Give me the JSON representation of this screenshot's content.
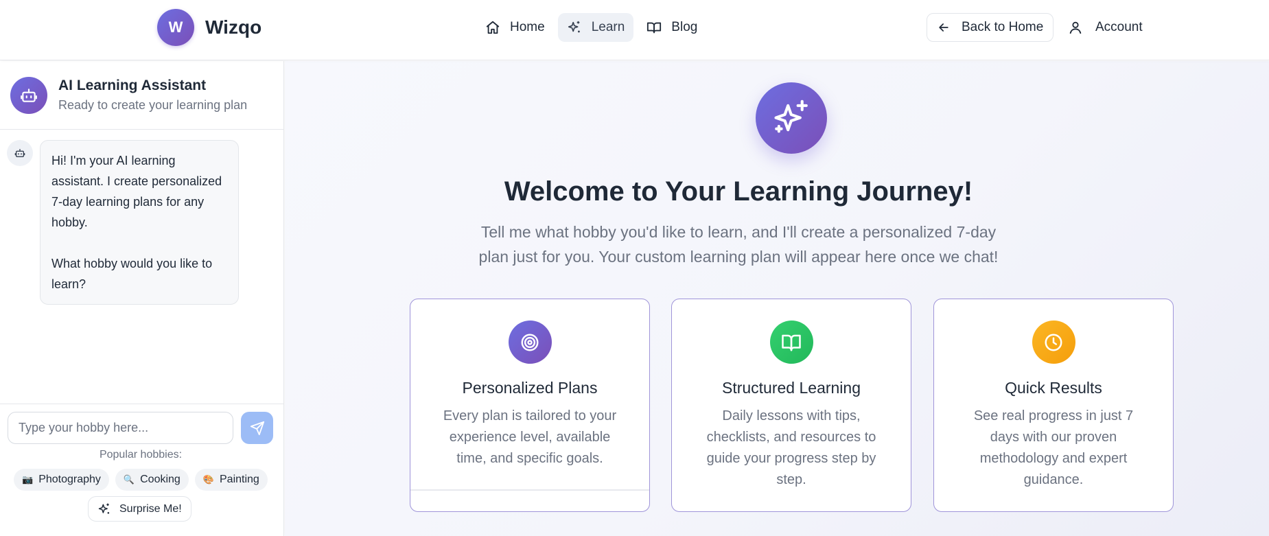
{
  "header": {
    "brand_letter": "W",
    "brand_name": "Wizqo",
    "nav": [
      {
        "label": "Home",
        "icon": "home-icon"
      },
      {
        "label": "Learn",
        "icon": "sparkles-icon",
        "active": true
      },
      {
        "label": "Blog",
        "icon": "book-icon"
      }
    ],
    "back_label": "Back to Home",
    "account_label": "Account"
  },
  "sidebar": {
    "assistant_title": "AI Learning Assistant",
    "assistant_status": "Ready to create your learning plan",
    "message_line1": "Hi! I'm your AI learning assistant. I create personalized 7-day learning plans for any hobby.",
    "message_line2": "What hobby would you like to learn?",
    "input_placeholder": "Type your hobby here...",
    "popular_label": "Popular hobbies:",
    "chips": [
      {
        "icon": "📷",
        "label": "Photography"
      },
      {
        "icon": "🔍",
        "label": "Cooking"
      },
      {
        "icon": "🎨",
        "label": "Painting"
      }
    ],
    "surprise_label": "Surprise Me!"
  },
  "main": {
    "title": "Welcome to Your Learning Journey!",
    "subtitle": "Tell me what hobby you'd like to learn, and I'll create a personalized 7-day plan just for you. Your custom learning plan will appear here once we chat!",
    "cards": [
      {
        "title": "Personalized Plans",
        "desc": "Every plan is tailored to your experience level, available time, and specific goals.",
        "icon": "target-icon",
        "color": "#6d5fd3"
      },
      {
        "title": "Structured Learning",
        "desc": "Daily lessons with tips, checklists, and resources to guide your progress step by step.",
        "icon": "open-book-icon",
        "color": "#2ec866"
      },
      {
        "title": "Quick Results",
        "desc": "See real progress in just 7 days with our proven methodology and expert guidance.",
        "icon": "clock-icon",
        "color": "#f7a51c"
      }
    ]
  },
  "colors": {
    "accent_gradient_start": "#6d6ee0",
    "accent_gradient_end": "#7b4fb8",
    "send_button": "#9cbcf6",
    "card_border": "#9f94d9"
  }
}
